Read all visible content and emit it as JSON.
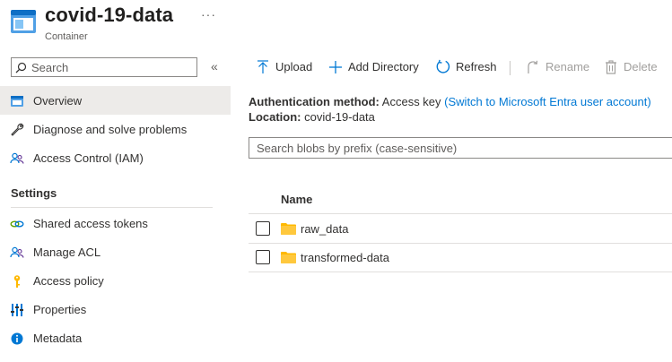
{
  "header": {
    "title": "covid-19-data",
    "subtitle": "Container",
    "more": "···"
  },
  "sidebar": {
    "search_placeholder": "Search",
    "collapse_glyph": "«",
    "items_top": [
      {
        "label": "Overview",
        "icon": "overview-icon",
        "active": true
      },
      {
        "label": "Diagnose and solve problems",
        "icon": "wrench-icon"
      },
      {
        "label": "Access Control (IAM)",
        "icon": "people-icon"
      }
    ],
    "settings_title": "Settings",
    "items_settings": [
      {
        "label": "Shared access tokens",
        "icon": "link-icon"
      },
      {
        "label": "Manage ACL",
        "icon": "people-icon"
      },
      {
        "label": "Access policy",
        "icon": "key-icon"
      },
      {
        "label": "Properties",
        "icon": "properties-icon"
      },
      {
        "label": "Metadata",
        "icon": "info-icon"
      }
    ]
  },
  "toolbar": {
    "upload": "Upload",
    "add_directory": "Add Directory",
    "refresh": "Refresh",
    "rename": "Rename",
    "delete": "Delete"
  },
  "auth": {
    "label": "Authentication method:",
    "value": "Access key",
    "switch_link": "(Switch to Microsoft Entra user account)"
  },
  "location": {
    "label": "Location:",
    "value": "covid-19-data"
  },
  "blob_search": {
    "placeholder": "Search blobs by prefix (case-sensitive)"
  },
  "table": {
    "name_header": "Name",
    "rows": [
      {
        "name": "raw_data"
      },
      {
        "name": "transformed-data"
      }
    ]
  },
  "colors": {
    "accent": "#0078d4",
    "folder": "#ffb900",
    "active_bg": "#edebe9"
  }
}
